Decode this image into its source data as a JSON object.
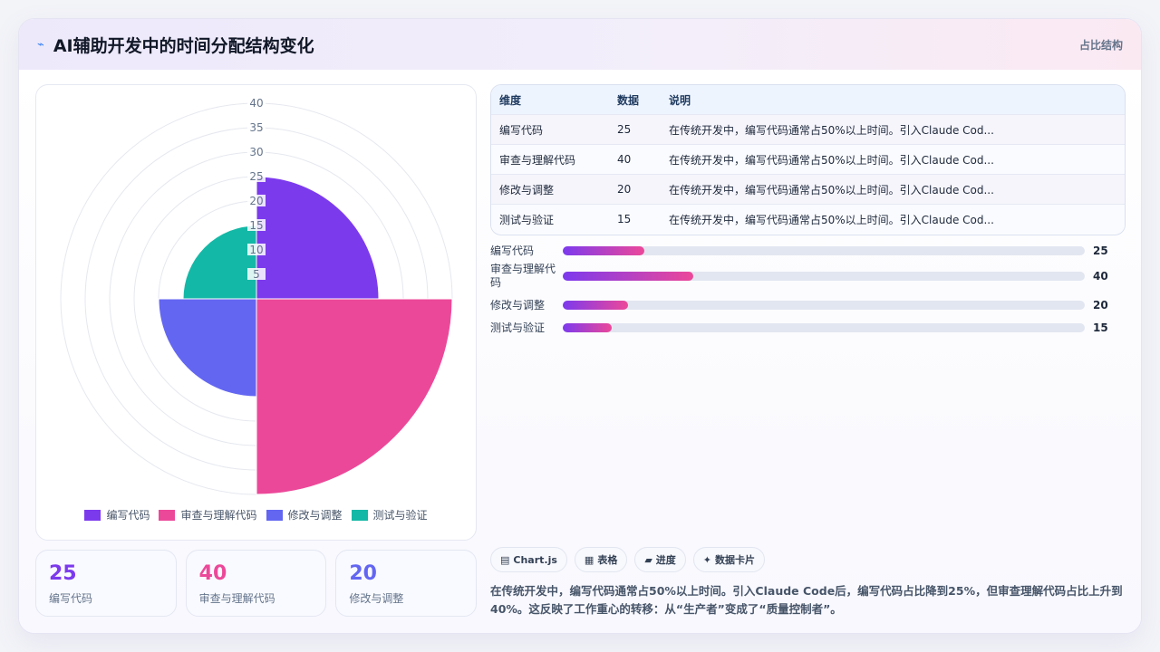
{
  "header": {
    "icon": "line-chart-icon",
    "title": "AI辅助开发中的时间分配结构变化",
    "tag": "占比结构"
  },
  "colors": {
    "purple": "#7c3aed",
    "pink": "#ec4899",
    "indigo": "#6366f1",
    "teal": "#14b8a6"
  },
  "chart_data": {
    "type": "polarArea",
    "categories": [
      "编写代码",
      "审查与理解代码",
      "修改与调整",
      "测试与验证"
    ],
    "values": [
      25,
      40,
      20,
      15
    ],
    "colors": [
      "#7c3aed",
      "#ec4899",
      "#6366f1",
      "#14b8a6"
    ],
    "r_ticks": [
      "5",
      "10",
      "15",
      "20",
      "25",
      "30",
      "35",
      "40"
    ],
    "rlim": [
      0,
      40
    ],
    "start_angle_deg": 0,
    "legend_position": "bottom",
    "grid": true
  },
  "table": {
    "headers": [
      "维度",
      "数据",
      "说明"
    ],
    "rows": [
      {
        "dim": "编写代码",
        "val": "25",
        "desc": "在传统开发中，编写代码通常占50%以上时间。引入Claude Cod..."
      },
      {
        "dim": "审查与理解代码",
        "val": "40",
        "desc": "在传统开发中，编写代码通常占50%以上时间。引入Claude Cod..."
      },
      {
        "dim": "修改与调整",
        "val": "20",
        "desc": "在传统开发中，编写代码通常占50%以上时间。引入Claude Cod..."
      },
      {
        "dim": "测试与验证",
        "val": "15",
        "desc": "在传统开发中，编写代码通常占50%以上时间。引入Claude Cod..."
      }
    ]
  },
  "progress": [
    {
      "label": "编写代码",
      "value": "25",
      "fraction": 0.156
    },
    {
      "label": "审查与理解代码",
      "value": "40",
      "fraction": 0.25
    },
    {
      "label": "修改与调整",
      "value": "20",
      "fraction": 0.125
    },
    {
      "label": "测试与验证",
      "value": "15",
      "fraction": 0.094
    }
  ],
  "stats": [
    {
      "value": "25",
      "label": "编写代码",
      "color": "#7c3aed"
    },
    {
      "value": "40",
      "label": "审查与理解代码",
      "color": "#ec4899"
    },
    {
      "value": "20",
      "label": "修改与调整",
      "color": "#6366f1"
    }
  ],
  "chips": [
    {
      "icon": "chart-icon",
      "glyph": "▤",
      "label": "Chart.js"
    },
    {
      "icon": "table-icon",
      "glyph": "▦",
      "label": "表格"
    },
    {
      "icon": "progress-icon",
      "glyph": "▰",
      "label": "进度"
    },
    {
      "icon": "sparkle-icon",
      "glyph": "✦",
      "label": "数据卡片"
    }
  ],
  "note": "在传统开发中，编写代码通常占50%以上时间。引入Claude Code后，编写代码占比降到25%，但审查理解代码占比上升到40%。这反映了工作重心的转移：从“生产者”变成了“质量控制者”。"
}
